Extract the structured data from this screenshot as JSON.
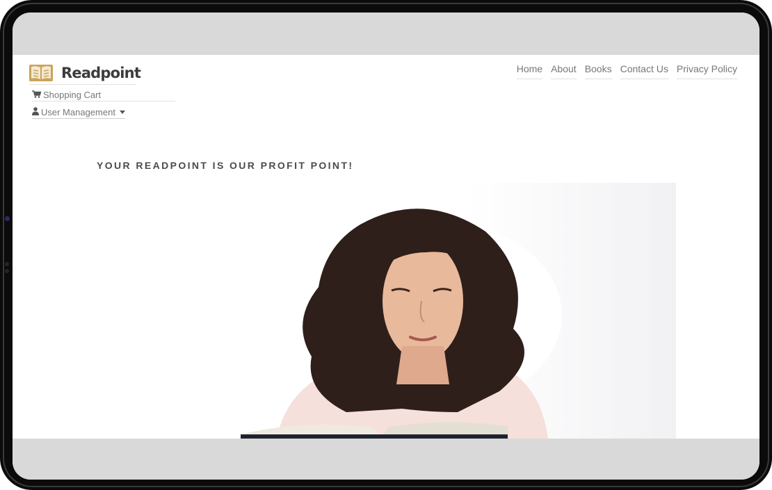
{
  "brand": {
    "name": "Readpoint",
    "accent": "#c9a35a",
    "icon": "open-book-icon"
  },
  "nav": {
    "items": [
      {
        "label": "Home"
      },
      {
        "label": "About"
      },
      {
        "label": "Books"
      },
      {
        "label": "Contact Us"
      },
      {
        "label": "Privacy Policy"
      }
    ]
  },
  "sidebar": {
    "cart_label": "Shopping Cart",
    "cart_icon": "shopping-cart-icon",
    "user_label": "User Management",
    "user_icon": "user-icon"
  },
  "hero": {
    "tagline": "YOUR READPOINT IS OUR PROFIT POINT!"
  },
  "colors": {
    "bezel": "#0b0b0b",
    "chrome": "#d9d9d9",
    "text": "#777777",
    "heading": "#4b4b4b"
  }
}
